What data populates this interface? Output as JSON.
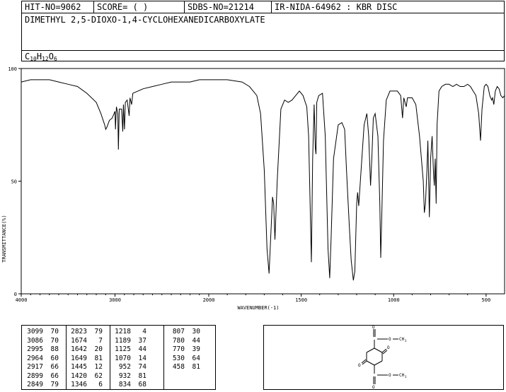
{
  "header": {
    "hit_no": "HIT-NO=9062",
    "score": "SCORE=  (   )",
    "sdbs_no": "SDBS-NO=21214",
    "ir_id": "IR-NIDA-64962 : KBR DISC",
    "compound_name": "DIMETHYL 2,5-DIOXO-1,4-CYCLOHEXANEDICARBOXYLATE",
    "formula_parts": {
      "c": "C",
      "c_n": "10",
      "h": "H",
      "h_n": "12",
      "o": "O",
      "o_n": "6"
    }
  },
  "chart_data": {
    "type": "line",
    "title": "",
    "xlabel": "WAVENUMBER(-1)",
    "ylabel": "TRANSMITTANCE(%)",
    "xlim": [
      4000,
      400
    ],
    "ylim": [
      0,
      100
    ],
    "x_ticks": [
      4000,
      3000,
      2000,
      1500,
      1000,
      500
    ],
    "x_tick_labels": [
      "4000",
      "3000",
      "2000",
      "1500",
      "1000",
      "500"
    ],
    "y_ticks": [
      0,
      50,
      100
    ],
    "y_tick_labels": [
      "0",
      "50",
      "100"
    ],
    "grid": false,
    "series": [
      {
        "points": [
          [
            4000,
            94
          ],
          [
            3900,
            95
          ],
          [
            3800,
            95
          ],
          [
            3700,
            95
          ],
          [
            3600,
            94
          ],
          [
            3500,
            93
          ],
          [
            3400,
            92
          ],
          [
            3300,
            89
          ],
          [
            3200,
            85
          ],
          [
            3150,
            80
          ],
          [
            3110,
            75
          ],
          [
            3099,
            73
          ],
          [
            3086,
            74
          ],
          [
            3060,
            77
          ],
          [
            3030,
            78
          ],
          [
            3010,
            80
          ],
          [
            3000,
            81
          ],
          [
            2995,
            73
          ],
          [
            2985,
            83
          ],
          [
            2970,
            80
          ],
          [
            2964,
            64
          ],
          [
            2955,
            82
          ],
          [
            2940,
            82
          ],
          [
            2930,
            82
          ],
          [
            2917,
            72
          ],
          [
            2910,
            84
          ],
          [
            2899,
            73
          ],
          [
            2890,
            85
          ],
          [
            2870,
            86
          ],
          [
            2849,
            79
          ],
          [
            2840,
            87
          ],
          [
            2823,
            84
          ],
          [
            2810,
            89
          ],
          [
            2700,
            91
          ],
          [
            2600,
            92
          ],
          [
            2500,
            93
          ],
          [
            2400,
            94
          ],
          [
            2300,
            94
          ],
          [
            2200,
            94
          ],
          [
            2100,
            95
          ],
          [
            2000,
            95
          ],
          [
            1900,
            95
          ],
          [
            1820,
            94
          ],
          [
            1780,
            92
          ],
          [
            1740,
            88
          ],
          [
            1720,
            80
          ],
          [
            1700,
            55
          ],
          [
            1685,
            20
          ],
          [
            1674,
            9
          ],
          [
            1665,
            25
          ],
          [
            1655,
            43
          ],
          [
            1649,
            40
          ],
          [
            1642,
            24
          ],
          [
            1630,
            50
          ],
          [
            1610,
            82
          ],
          [
            1590,
            86
          ],
          [
            1570,
            85
          ],
          [
            1550,
            86
          ],
          [
            1530,
            88
          ],
          [
            1510,
            90
          ],
          [
            1490,
            88
          ],
          [
            1470,
            83
          ],
          [
            1460,
            70
          ],
          [
            1452,
            40
          ],
          [
            1445,
            14
          ],
          [
            1438,
            60
          ],
          [
            1430,
            84
          ],
          [
            1424,
            65
          ],
          [
            1420,
            62
          ],
          [
            1416,
            85
          ],
          [
            1405,
            88
          ],
          [
            1385,
            89
          ],
          [
            1370,
            70
          ],
          [
            1355,
            20
          ],
          [
            1346,
            7
          ],
          [
            1338,
            25
          ],
          [
            1325,
            60
          ],
          [
            1300,
            75
          ],
          [
            1280,
            76
          ],
          [
            1265,
            73
          ],
          [
            1255,
            55
          ],
          [
            1240,
            30
          ],
          [
            1230,
            15
          ],
          [
            1218,
            6
          ],
          [
            1210,
            10
          ],
          [
            1200,
            40
          ],
          [
            1195,
            45
          ],
          [
            1189,
            39
          ],
          [
            1180,
            50
          ],
          [
            1160,
            75
          ],
          [
            1145,
            80
          ],
          [
            1135,
            70
          ],
          [
            1125,
            48
          ],
          [
            1118,
            60
          ],
          [
            1110,
            78
          ],
          [
            1100,
            80
          ],
          [
            1085,
            70
          ],
          [
            1075,
            40
          ],
          [
            1070,
            16
          ],
          [
            1064,
            35
          ],
          [
            1055,
            68
          ],
          [
            1040,
            86
          ],
          [
            1020,
            90
          ],
          [
            1000,
            90
          ],
          [
            980,
            90
          ],
          [
            962,
            88
          ],
          [
            952,
            78
          ],
          [
            945,
            87
          ],
          [
            932,
            83
          ],
          [
            925,
            87
          ],
          [
            900,
            87
          ],
          [
            880,
            84
          ],
          [
            860,
            70
          ],
          [
            840,
            50
          ],
          [
            834,
            36
          ],
          [
            828,
            40
          ],
          [
            820,
            55
          ],
          [
            815,
            68
          ],
          [
            807,
            34
          ],
          [
            800,
            60
          ],
          [
            792,
            70
          ],
          [
            785,
            55
          ],
          [
            780,
            48
          ],
          [
            775,
            60
          ],
          [
            770,
            40
          ],
          [
            765,
            75
          ],
          [
            755,
            90
          ],
          [
            740,
            92
          ],
          [
            720,
            93
          ],
          [
            700,
            93
          ],
          [
            680,
            92
          ],
          [
            660,
            93
          ],
          [
            640,
            92
          ],
          [
            620,
            92
          ],
          [
            600,
            93
          ],
          [
            585,
            92
          ],
          [
            570,
            90
          ],
          [
            555,
            88
          ],
          [
            540,
            80
          ],
          [
            530,
            68
          ],
          [
            522,
            82
          ],
          [
            510,
            92
          ],
          [
            500,
            93
          ],
          [
            490,
            92
          ],
          [
            480,
            88
          ],
          [
            470,
            86
          ],
          [
            465,
            87
          ],
          [
            458,
            84
          ],
          [
            450,
            90
          ],
          [
            440,
            92
          ],
          [
            430,
            91
          ],
          [
            420,
            88
          ],
          [
            410,
            87
          ],
          [
            400,
            88
          ]
        ]
      }
    ],
    "peak_table": [
      [
        [
          3099,
          70
        ],
        [
          3086,
          70
        ],
        [
          2995,
          88
        ],
        [
          2964,
          60
        ],
        [
          2917,
          66
        ],
        [
          2899,
          66
        ],
        [
          2849,
          79
        ]
      ],
      [
        [
          2823,
          79
        ],
        [
          1674,
          7
        ],
        [
          1642,
          20
        ],
        [
          1649,
          81
        ],
        [
          1445,
          12
        ],
        [
          1420,
          62
        ],
        [
          1346,
          6
        ]
      ],
      [
        [
          1218,
          4
        ],
        [
          1189,
          37
        ],
        [
          1125,
          44
        ],
        [
          1070,
          14
        ],
        [
          952,
          74
        ],
        [
          932,
          81
        ],
        [
          834,
          68
        ]
      ],
      [
        [
          807,
          30
        ],
        [
          780,
          44
        ],
        [
          770,
          39
        ],
        [
          530,
          64
        ],
        [
          458,
          81
        ]
      ]
    ]
  },
  "structure": {
    "carbonyl_o": "O",
    "ring_o": "O",
    "methyl": "CH",
    "methyl_sub": "3"
  }
}
